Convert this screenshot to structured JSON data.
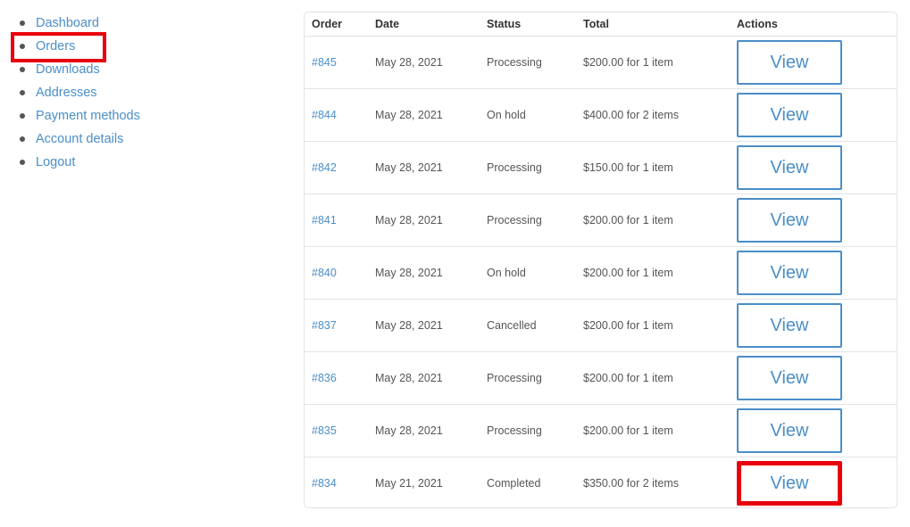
{
  "nav": {
    "items": [
      {
        "label": "Dashboard"
      },
      {
        "label": "Orders"
      },
      {
        "label": "Downloads"
      },
      {
        "label": "Addresses"
      },
      {
        "label": "Payment methods"
      },
      {
        "label": "Account details"
      },
      {
        "label": "Logout"
      }
    ]
  },
  "orders": {
    "headers": {
      "order": "Order",
      "date": "Date",
      "status": "Status",
      "total": "Total",
      "actions": "Actions"
    },
    "view_label": "View",
    "rows": [
      {
        "number": "#845",
        "date": "May 28, 2021",
        "status": "Processing",
        "total": "$200.00 for 1 item"
      },
      {
        "number": "#844",
        "date": "May 28, 2021",
        "status": "On hold",
        "total": "$400.00 for 2 items"
      },
      {
        "number": "#842",
        "date": "May 28, 2021",
        "status": "Processing",
        "total": "$150.00 for 1 item"
      },
      {
        "number": "#841",
        "date": "May 28, 2021",
        "status": "Processing",
        "total": "$200.00 for 1 item"
      },
      {
        "number": "#840",
        "date": "May 28, 2021",
        "status": "On hold",
        "total": "$200.00 for 1 item"
      },
      {
        "number": "#837",
        "date": "May 28, 2021",
        "status": "Cancelled",
        "total": "$200.00 for 1 item"
      },
      {
        "number": "#836",
        "date": "May 28, 2021",
        "status": "Processing",
        "total": "$200.00 for 1 item"
      },
      {
        "number": "#835",
        "date": "May 28, 2021",
        "status": "Processing",
        "total": "$200.00 for 1 item"
      },
      {
        "number": "#834",
        "date": "May 21, 2021",
        "status": "Completed",
        "total": "$350.00 for 2 items"
      }
    ]
  },
  "colors": {
    "link": "#4a8ec8",
    "highlight": "#e8000b",
    "border": "#e3e3e3"
  }
}
